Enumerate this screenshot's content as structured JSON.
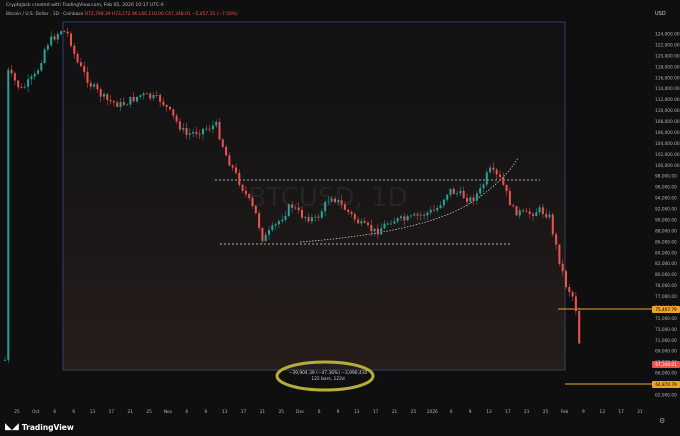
{
  "header": {
    "credit": "CryptoJack created with TradingView.com, Feb 05, 2026 10:17 UTC-6",
    "symbol": "Bitcoin / U.S. Dollar · 1D · Coinbase",
    "ohlc": "O72,799.39 H73,172.96 L66,110.00 C67,348.01 −5,457.15 (−7.50%)",
    "currency": "USD"
  },
  "watermark": {
    "ticker": "BTCUSD, 1D"
  },
  "price_axis": {
    "labels": [
      "124,000.00",
      "122,000.00",
      "120,000.00",
      "118,000.00",
      "116,000.00",
      "114,000.00",
      "112,000.00",
      "110,000.00",
      "108,000.00",
      "106,000.00",
      "104,000.00",
      "102,000.00",
      "100,000.00",
      "98,000.00",
      "96,000.00",
      "94,000.00",
      "92,000.00",
      "90,000.00",
      "88,000.00",
      "86,000.00",
      "84,000.00",
      "82,000.00",
      "80,000.00",
      "78,000.00",
      "77,000.00",
      "76,000.00",
      "75,000.00",
      "73,000.00",
      "71,000.00",
      "69,000.00",
      "68,000.00",
      "66,000.00",
      "64,000.00",
      "62,000.00"
    ],
    "badges": {
      "orange_top": "75,407.79",
      "current": "67,348.01",
      "orange_bottom": "64,870.79"
    }
  },
  "time_axis": {
    "labels": [
      "25",
      "Oct",
      "6",
      "9",
      "13",
      "17",
      "21",
      "25",
      "Nov",
      "6",
      "9",
      "13",
      "17",
      "21",
      "25",
      "Dec",
      "6",
      "9",
      "13",
      "17",
      "21",
      "25",
      "2026",
      "6",
      "9",
      "13",
      "17",
      "21",
      "25",
      "Feb",
      "9",
      "13",
      "17",
      "21"
    ]
  },
  "measure": {
    "line1": "−39,904.39 (−47.36%) −3,990,430",
    "line2": "122 bars, 122d"
  },
  "footer": {
    "brand": "TradingView"
  },
  "colors": {
    "up": "#26a69a",
    "down": "#ef5350",
    "accent": "#f0a32a",
    "frame": "#3c4a7a",
    "highlight": "#b5ad3a"
  },
  "icons": {
    "settings": "gear-icon",
    "logo": "tradingview-logo-icon"
  }
}
